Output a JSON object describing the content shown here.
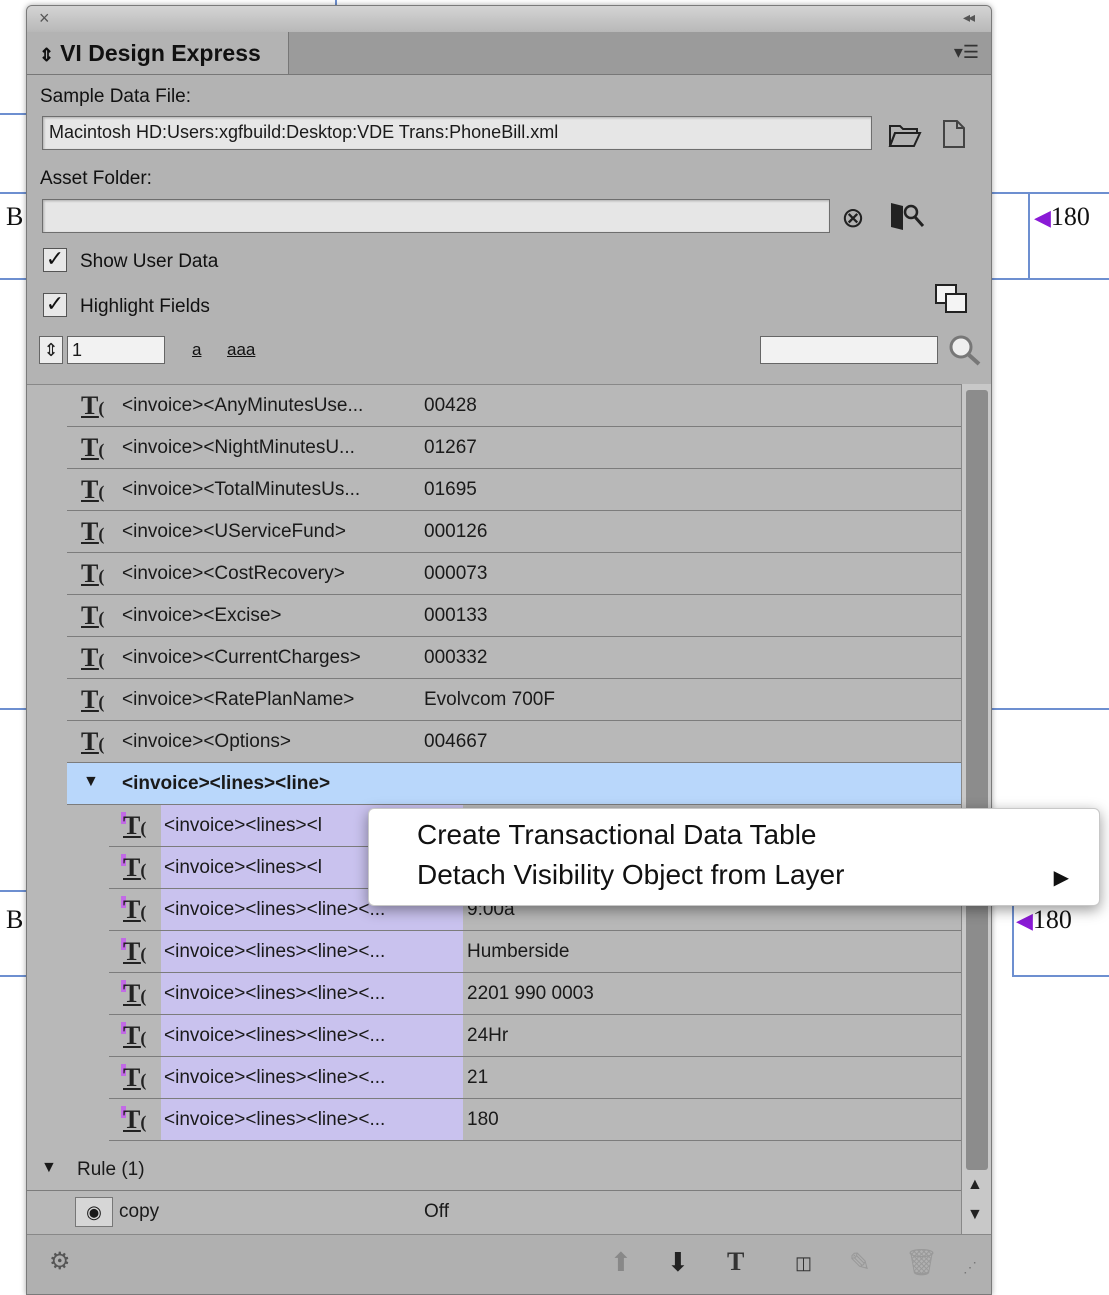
{
  "background": {
    "left_letter_top": "B",
    "left_letter_bottom": "B",
    "right_value_top": "180",
    "right_value_bottom": "180"
  },
  "panel": {
    "tab_title": "VI Design Express",
    "sample_data_label": "Sample Data File:",
    "sample_data_path": "Macintosh HD:Users:xgfbuild:Desktop:VDE Trans:PhoneBill.xml",
    "asset_folder_label": "Asset Folder:",
    "asset_folder_value": "",
    "show_user_data_label": "Show User Data",
    "show_user_data_checked": true,
    "highlight_fields_label": "Highlight Fields",
    "highlight_fields_checked": true,
    "record_number": "1",
    "case_small": "a",
    "case_multi": "aaa",
    "search_value": ""
  },
  "fields": [
    {
      "tag": "<invoice><AnyMinutesUse...",
      "value": "00428"
    },
    {
      "tag": "<invoice><NightMinutesU...",
      "value": "01267"
    },
    {
      "tag": "<invoice><TotalMinutesUs...",
      "value": "01695"
    },
    {
      "tag": "<invoice><UServiceFund>",
      "value": "000126"
    },
    {
      "tag": "<invoice><CostRecovery>",
      "value": "000073"
    },
    {
      "tag": "<invoice><Excise>",
      "value": "000133"
    },
    {
      "tag": "<invoice><CurrentCharges>",
      "value": "000332"
    },
    {
      "tag": "<invoice><RatePlanName>",
      "value": "Evolvcom 700F"
    },
    {
      "tag": "<invoice><Options>",
      "value": "004667"
    }
  ],
  "group": {
    "label": "<invoice><lines><line>"
  },
  "line_fields": [
    {
      "tag": "<invoice><lines><l",
      "value": ""
    },
    {
      "tag": "<invoice><lines><l",
      "value": ""
    },
    {
      "tag": "<invoice><lines><line><...",
      "value": "9:00a"
    },
    {
      "tag": "<invoice><lines><line><...",
      "value": "Humberside"
    },
    {
      "tag": "<invoice><lines><line><...",
      "value": "2201 990 0003"
    },
    {
      "tag": "<invoice><lines><line><...",
      "value": "24Hr"
    },
    {
      "tag": "<invoice><lines><line><...",
      "value": "21"
    },
    {
      "tag": "<invoice><lines><line><...",
      "value": "180"
    }
  ],
  "rule_group": {
    "label": "Rule (1)",
    "rule_name": "copy",
    "rule_value": "Off"
  },
  "context_menu": {
    "item1": "Create Transactional Data Table",
    "item2": "Detach Visibility Object from Layer"
  },
  "icons": [
    "close-icon",
    "collapse-icon",
    "panel-menu-icon",
    "open-folder-icon",
    "new-file-icon",
    "clear-icon",
    "browse-folder-icon",
    "layers-icon",
    "search-icon",
    "gear-icon",
    "move-up-icon",
    "move-down-icon",
    "insert-field-icon",
    "insert-small-field-icon",
    "edit-pen-icon",
    "trash-icon",
    "resize-grip-icon",
    "submenu-arrow-icon"
  ]
}
